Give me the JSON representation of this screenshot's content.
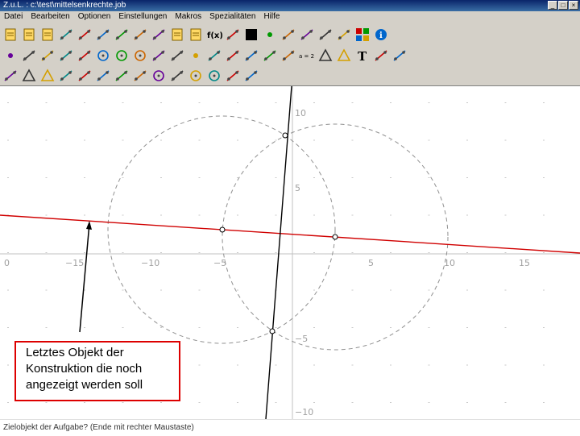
{
  "window": {
    "title": "Z.u.L. : c:\\test\\mittelsenkrechte.job"
  },
  "window_buttons": [
    {
      "name": "minimize-button",
      "label": "_"
    },
    {
      "name": "maximize-button",
      "label": "□"
    },
    {
      "name": "close-button",
      "label": "×"
    }
  ],
  "menu": [
    "Datei",
    "Bearbeiten",
    "Optionen",
    "Einstellungen",
    "Makros",
    "Spezialitäten",
    "Hilfe"
  ],
  "toolbar": {
    "row1": [
      "new-file-icon",
      "open-file-icon",
      "save-icon",
      "undo-icon",
      "delete-icon",
      "redo-icon",
      "wand-icon",
      "paint-icon",
      "hide-icon",
      "comment-icon",
      "clipboard-icon",
      "function-icon",
      "arrows-icon",
      "color-black-icon",
      "point-size-icon",
      "line-size-icon",
      "zoom-icon",
      "axis-icon",
      "macro-icon",
      "grid-colors-icon",
      "info-icon"
    ],
    "row2": [
      "point-icon",
      "line-icon",
      "ray-icon",
      "segment-icon",
      "fixed-segment-icon",
      "circle-icon",
      "circle-radius-icon",
      "fixed-circle-icon",
      "parallel-icon",
      "perpendicular-icon",
      "midpoint-icon",
      "angle-icon",
      "fixed-angle-icon",
      "move-icon",
      "tangent-icon",
      "video-icon",
      "equation-icon",
      "polygon-icon",
      "polygon2-icon",
      "text-icon",
      "tracker-icon",
      "animate-icon"
    ],
    "row3": [
      "locus-icon",
      "triangle-icon",
      "triangle2-icon",
      "intersection-icon",
      "line2-icon",
      "ray2-icon",
      "segment2-icon",
      "mirror-icon",
      "circle2-icon",
      "bisector-icon",
      "compass-icon",
      "arc-icon",
      "chord-icon",
      "chord2-icon"
    ],
    "function_label": "f(x)",
    "equation_label": "a = 2",
    "text_tool_label": "T"
  },
  "canvas": {
    "x_ticks": [
      "0",
      "−15",
      "−10",
      "−5",
      "5",
      "10",
      "15"
    ],
    "y_ticks": [
      "10",
      "5",
      "−5",
      "−10"
    ]
  },
  "callout": {
    "text": "Letztes Objekt der Konstruktion die noch angezeigt werden soll"
  },
  "colors": {
    "red_line": "#d00000",
    "black_line": "#000000",
    "dashed_circle": "#909090"
  },
  "status": {
    "text": "Zielobjekt der Aufgabe? (Ende mit rechter Maustaste)"
  }
}
